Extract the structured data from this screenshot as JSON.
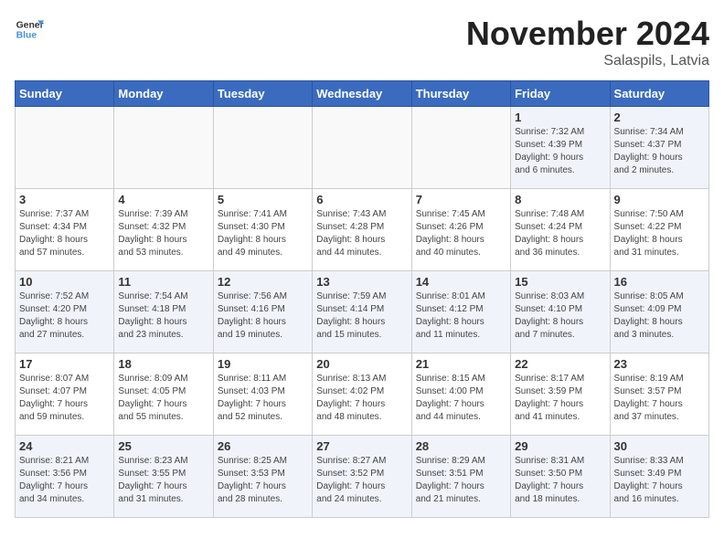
{
  "header": {
    "logo_line1": "General",
    "logo_line2": "Blue",
    "month_title": "November 2024",
    "location": "Salaspils, Latvia"
  },
  "weekdays": [
    "Sunday",
    "Monday",
    "Tuesday",
    "Wednesday",
    "Thursday",
    "Friday",
    "Saturday"
  ],
  "weeks": [
    [
      {
        "day": "",
        "info": ""
      },
      {
        "day": "",
        "info": ""
      },
      {
        "day": "",
        "info": ""
      },
      {
        "day": "",
        "info": ""
      },
      {
        "day": "",
        "info": ""
      },
      {
        "day": "1",
        "info": "Sunrise: 7:32 AM\nSunset: 4:39 PM\nDaylight: 9 hours\nand 6 minutes."
      },
      {
        "day": "2",
        "info": "Sunrise: 7:34 AM\nSunset: 4:37 PM\nDaylight: 9 hours\nand 2 minutes."
      }
    ],
    [
      {
        "day": "3",
        "info": "Sunrise: 7:37 AM\nSunset: 4:34 PM\nDaylight: 8 hours\nand 57 minutes."
      },
      {
        "day": "4",
        "info": "Sunrise: 7:39 AM\nSunset: 4:32 PM\nDaylight: 8 hours\nand 53 minutes."
      },
      {
        "day": "5",
        "info": "Sunrise: 7:41 AM\nSunset: 4:30 PM\nDaylight: 8 hours\nand 49 minutes."
      },
      {
        "day": "6",
        "info": "Sunrise: 7:43 AM\nSunset: 4:28 PM\nDaylight: 8 hours\nand 44 minutes."
      },
      {
        "day": "7",
        "info": "Sunrise: 7:45 AM\nSunset: 4:26 PM\nDaylight: 8 hours\nand 40 minutes."
      },
      {
        "day": "8",
        "info": "Sunrise: 7:48 AM\nSunset: 4:24 PM\nDaylight: 8 hours\nand 36 minutes."
      },
      {
        "day": "9",
        "info": "Sunrise: 7:50 AM\nSunset: 4:22 PM\nDaylight: 8 hours\nand 31 minutes."
      }
    ],
    [
      {
        "day": "10",
        "info": "Sunrise: 7:52 AM\nSunset: 4:20 PM\nDaylight: 8 hours\nand 27 minutes."
      },
      {
        "day": "11",
        "info": "Sunrise: 7:54 AM\nSunset: 4:18 PM\nDaylight: 8 hours\nand 23 minutes."
      },
      {
        "day": "12",
        "info": "Sunrise: 7:56 AM\nSunset: 4:16 PM\nDaylight: 8 hours\nand 19 minutes."
      },
      {
        "day": "13",
        "info": "Sunrise: 7:59 AM\nSunset: 4:14 PM\nDaylight: 8 hours\nand 15 minutes."
      },
      {
        "day": "14",
        "info": "Sunrise: 8:01 AM\nSunset: 4:12 PM\nDaylight: 8 hours\nand 11 minutes."
      },
      {
        "day": "15",
        "info": "Sunrise: 8:03 AM\nSunset: 4:10 PM\nDaylight: 8 hours\nand 7 minutes."
      },
      {
        "day": "16",
        "info": "Sunrise: 8:05 AM\nSunset: 4:09 PM\nDaylight: 8 hours\nand 3 minutes."
      }
    ],
    [
      {
        "day": "17",
        "info": "Sunrise: 8:07 AM\nSunset: 4:07 PM\nDaylight: 7 hours\nand 59 minutes."
      },
      {
        "day": "18",
        "info": "Sunrise: 8:09 AM\nSunset: 4:05 PM\nDaylight: 7 hours\nand 55 minutes."
      },
      {
        "day": "19",
        "info": "Sunrise: 8:11 AM\nSunset: 4:03 PM\nDaylight: 7 hours\nand 52 minutes."
      },
      {
        "day": "20",
        "info": "Sunrise: 8:13 AM\nSunset: 4:02 PM\nDaylight: 7 hours\nand 48 minutes."
      },
      {
        "day": "21",
        "info": "Sunrise: 8:15 AM\nSunset: 4:00 PM\nDaylight: 7 hours\nand 44 minutes."
      },
      {
        "day": "22",
        "info": "Sunrise: 8:17 AM\nSunset: 3:59 PM\nDaylight: 7 hours\nand 41 minutes."
      },
      {
        "day": "23",
        "info": "Sunrise: 8:19 AM\nSunset: 3:57 PM\nDaylight: 7 hours\nand 37 minutes."
      }
    ],
    [
      {
        "day": "24",
        "info": "Sunrise: 8:21 AM\nSunset: 3:56 PM\nDaylight: 7 hours\nand 34 minutes."
      },
      {
        "day": "25",
        "info": "Sunrise: 8:23 AM\nSunset: 3:55 PM\nDaylight: 7 hours\nand 31 minutes."
      },
      {
        "day": "26",
        "info": "Sunrise: 8:25 AM\nSunset: 3:53 PM\nDaylight: 7 hours\nand 28 minutes."
      },
      {
        "day": "27",
        "info": "Sunrise: 8:27 AM\nSunset: 3:52 PM\nDaylight: 7 hours\nand 24 minutes."
      },
      {
        "day": "28",
        "info": "Sunrise: 8:29 AM\nSunset: 3:51 PM\nDaylight: 7 hours\nand 21 minutes."
      },
      {
        "day": "29",
        "info": "Sunrise: 8:31 AM\nSunset: 3:50 PM\nDaylight: 7 hours\nand 18 minutes."
      },
      {
        "day": "30",
        "info": "Sunrise: 8:33 AM\nSunset: 3:49 PM\nDaylight: 7 hours\nand 16 minutes."
      }
    ]
  ]
}
